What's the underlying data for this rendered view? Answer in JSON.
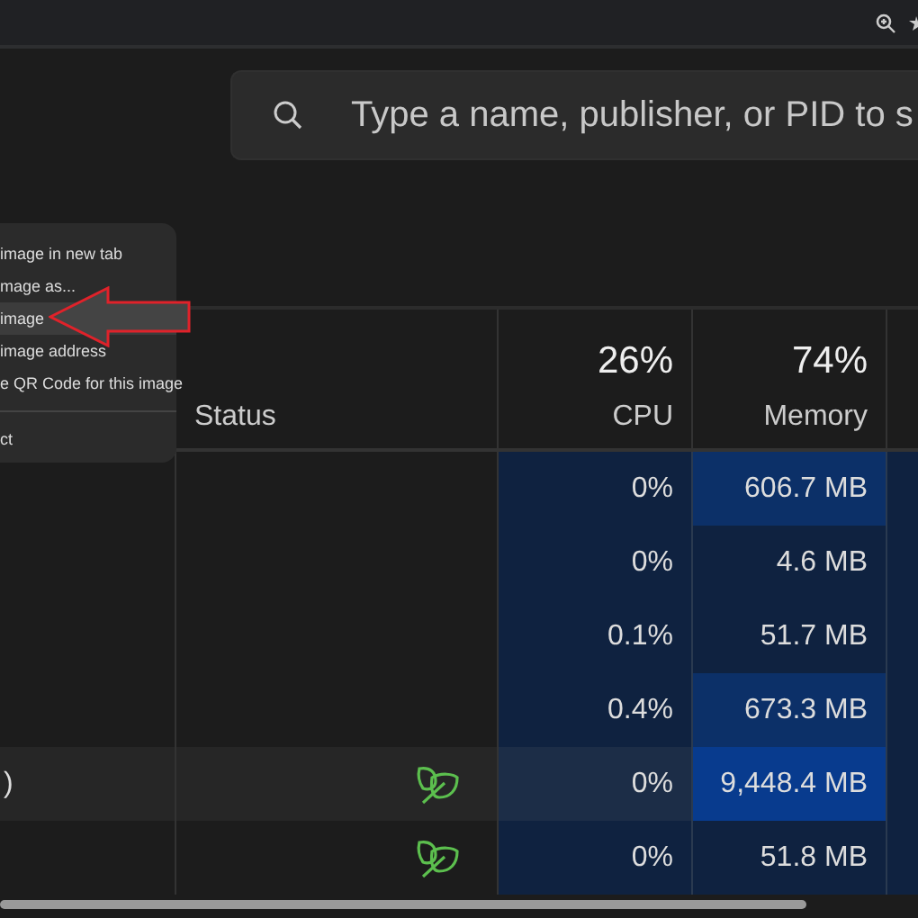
{
  "search": {
    "placeholder": "Type a name, publisher, or PID to s"
  },
  "columns": [
    {},
    {
      "label": "Status"
    },
    {
      "percent": "26%",
      "label": "CPU"
    },
    {
      "percent": "74%",
      "label": "Memory"
    }
  ],
  "rows": [
    {
      "efficiency": false,
      "hovered": false,
      "cpu": "0%",
      "memory": "606.7 MB",
      "color": "#0c3068"
    },
    {
      "efficiency": false,
      "hovered": false,
      "cpu": "0%",
      "memory": "4.6 MB",
      "color": "#0f2240"
    },
    {
      "efficiency": false,
      "hovered": false,
      "cpu": "0.1%",
      "memory": "51.7 MB",
      "color": "#0f2240"
    },
    {
      "efficiency": false,
      "hovered": false,
      "cpu": "0.4%",
      "memory": "673.3 MB",
      "color": "#0c3068"
    },
    {
      "name": ")",
      "efficiency": true,
      "hovered": true,
      "cpu": "0%",
      "memory": "9,448.4 MB",
      "color": "#083b8e"
    },
    {
      "efficiency": true,
      "hovered": false,
      "cpu": "0%",
      "memory": "51.8 MB",
      "color": "#0f2240"
    }
  ],
  "context_menu": {
    "items": [
      {
        "label": "image in new tab",
        "hovered": false,
        "separator_before": false
      },
      {
        "label": "mage as...",
        "hovered": false,
        "separator_before": false
      },
      {
        "label": "image",
        "hovered": true,
        "separator_before": false
      },
      {
        "label": "image address",
        "hovered": false,
        "separator_before": false
      },
      {
        "label": "e QR Code for this image",
        "hovered": false,
        "separator_before": false
      },
      {
        "label": "ct",
        "hovered": false,
        "separator_before": true
      }
    ]
  }
}
